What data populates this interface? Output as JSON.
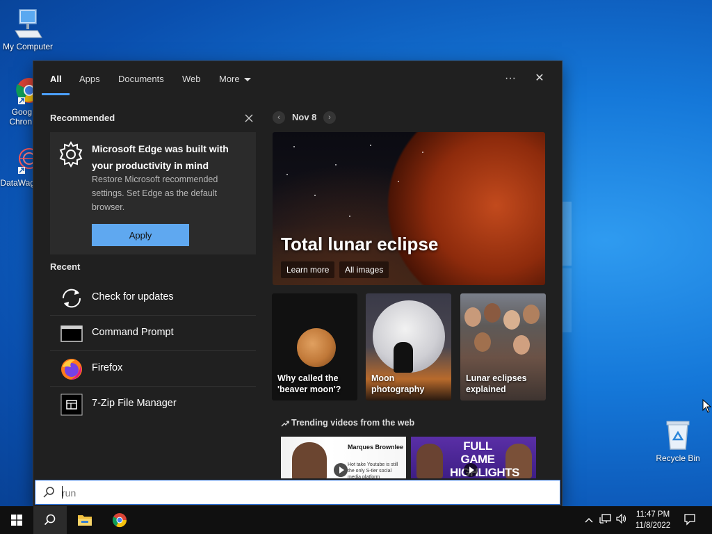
{
  "desktop": {
    "icons": [
      {
        "label": "My Computer"
      },
      {
        "label": "Goog Chron"
      },
      {
        "label": "DataWag"
      },
      {
        "label": "Recycle Bin"
      }
    ]
  },
  "search_panel": {
    "tabs": [
      {
        "label": "All",
        "active": true
      },
      {
        "label": "Apps"
      },
      {
        "label": "Documents"
      },
      {
        "label": "Web"
      },
      {
        "label": "More"
      }
    ],
    "more_options_glyph": "···",
    "close_glyph": "✕",
    "recommended": {
      "title": "Recommended",
      "card": {
        "title": "Microsoft Edge was built with your productivity in mind",
        "description": "Restore Microsoft recommended settings. Set Edge as the default browser.",
        "button_label": "Apply",
        "icon": "gear-icon"
      }
    },
    "recent": {
      "title": "Recent",
      "items": [
        {
          "label": "Check for updates",
          "icon": "refresh-icon"
        },
        {
          "label": "Command Prompt",
          "icon": "terminal-icon"
        },
        {
          "label": "Firefox",
          "icon": "firefox-icon"
        },
        {
          "label": "7-Zip File Manager",
          "icon": "7zip-icon"
        }
      ]
    },
    "news": {
      "date": "Nov 8",
      "hero": {
        "title": "Total lunar eclipse",
        "links": [
          "Learn more",
          "All images"
        ]
      },
      "tiles": [
        {
          "label": "Why called the 'beaver moon'?"
        },
        {
          "label": "Moon photography"
        },
        {
          "label": "Lunar eclipses explained"
        }
      ],
      "trending_title": "Trending videos from the web",
      "videos": [
        {
          "title": "Marques Brownlee",
          "text": "Hot take Youtube is still the only S-tier social media platform"
        },
        {
          "title": "FULL GAME HIGHLIGHTS"
        }
      ]
    }
  },
  "search": {
    "value": "run"
  },
  "taskbar": {
    "clock_time": "11:47 PM",
    "clock_date": "11/8/2022"
  },
  "colors": {
    "accent": "#4ca0ff",
    "apply_button": "#5fa8f0",
    "panel_bg": "#202020"
  }
}
